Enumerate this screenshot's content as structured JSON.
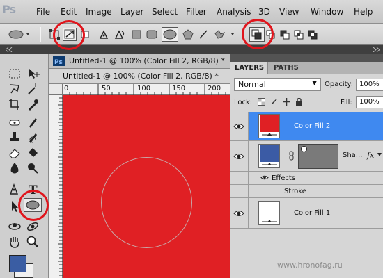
{
  "app": {
    "logo": "Ps"
  },
  "menu": [
    "File",
    "Edit",
    "Image",
    "Layer",
    "Select",
    "Filter",
    "Analysis",
    "3D",
    "View",
    "Window",
    "Help"
  ],
  "document": {
    "outer_tab": "Untitled-1 @ 100% (Color Fill 2, RGB/8) *",
    "inner_tab": "Untitled-1 @ 100% (Color Fill 2, RGB/8) *",
    "ruler_ticks": [
      "0",
      "50",
      "100",
      "150",
      "200"
    ],
    "canvas_color": "#e02024"
  },
  "layers_panel": {
    "tab_layers": "LAYERS",
    "tab_paths": "PATHS",
    "blend_mode": "Normal",
    "opacity_label": "Opacity:",
    "opacity_value": "100%",
    "lock_label": "Lock:",
    "fill_label": "Fill:",
    "fill_value": "100%",
    "layers": [
      {
        "name": "Color Fill 2",
        "thumb_color": "#e02024",
        "selected": true
      },
      {
        "name": "Sha...",
        "thumb_color": "#3b5ba5",
        "mask_color": "#7a7a7a",
        "fx": "fx"
      },
      {
        "name": "Color Fill 1",
        "thumb_color": "#ffffff"
      }
    ],
    "effects_label": "Effects",
    "stroke_label": "Stroke"
  },
  "watermark": "www.hronofag.ru",
  "colors": {
    "accent_highlight": "#3f89f0",
    "annotation_ring": "#e0151c",
    "foreground_swatch": "#3a5da3"
  }
}
